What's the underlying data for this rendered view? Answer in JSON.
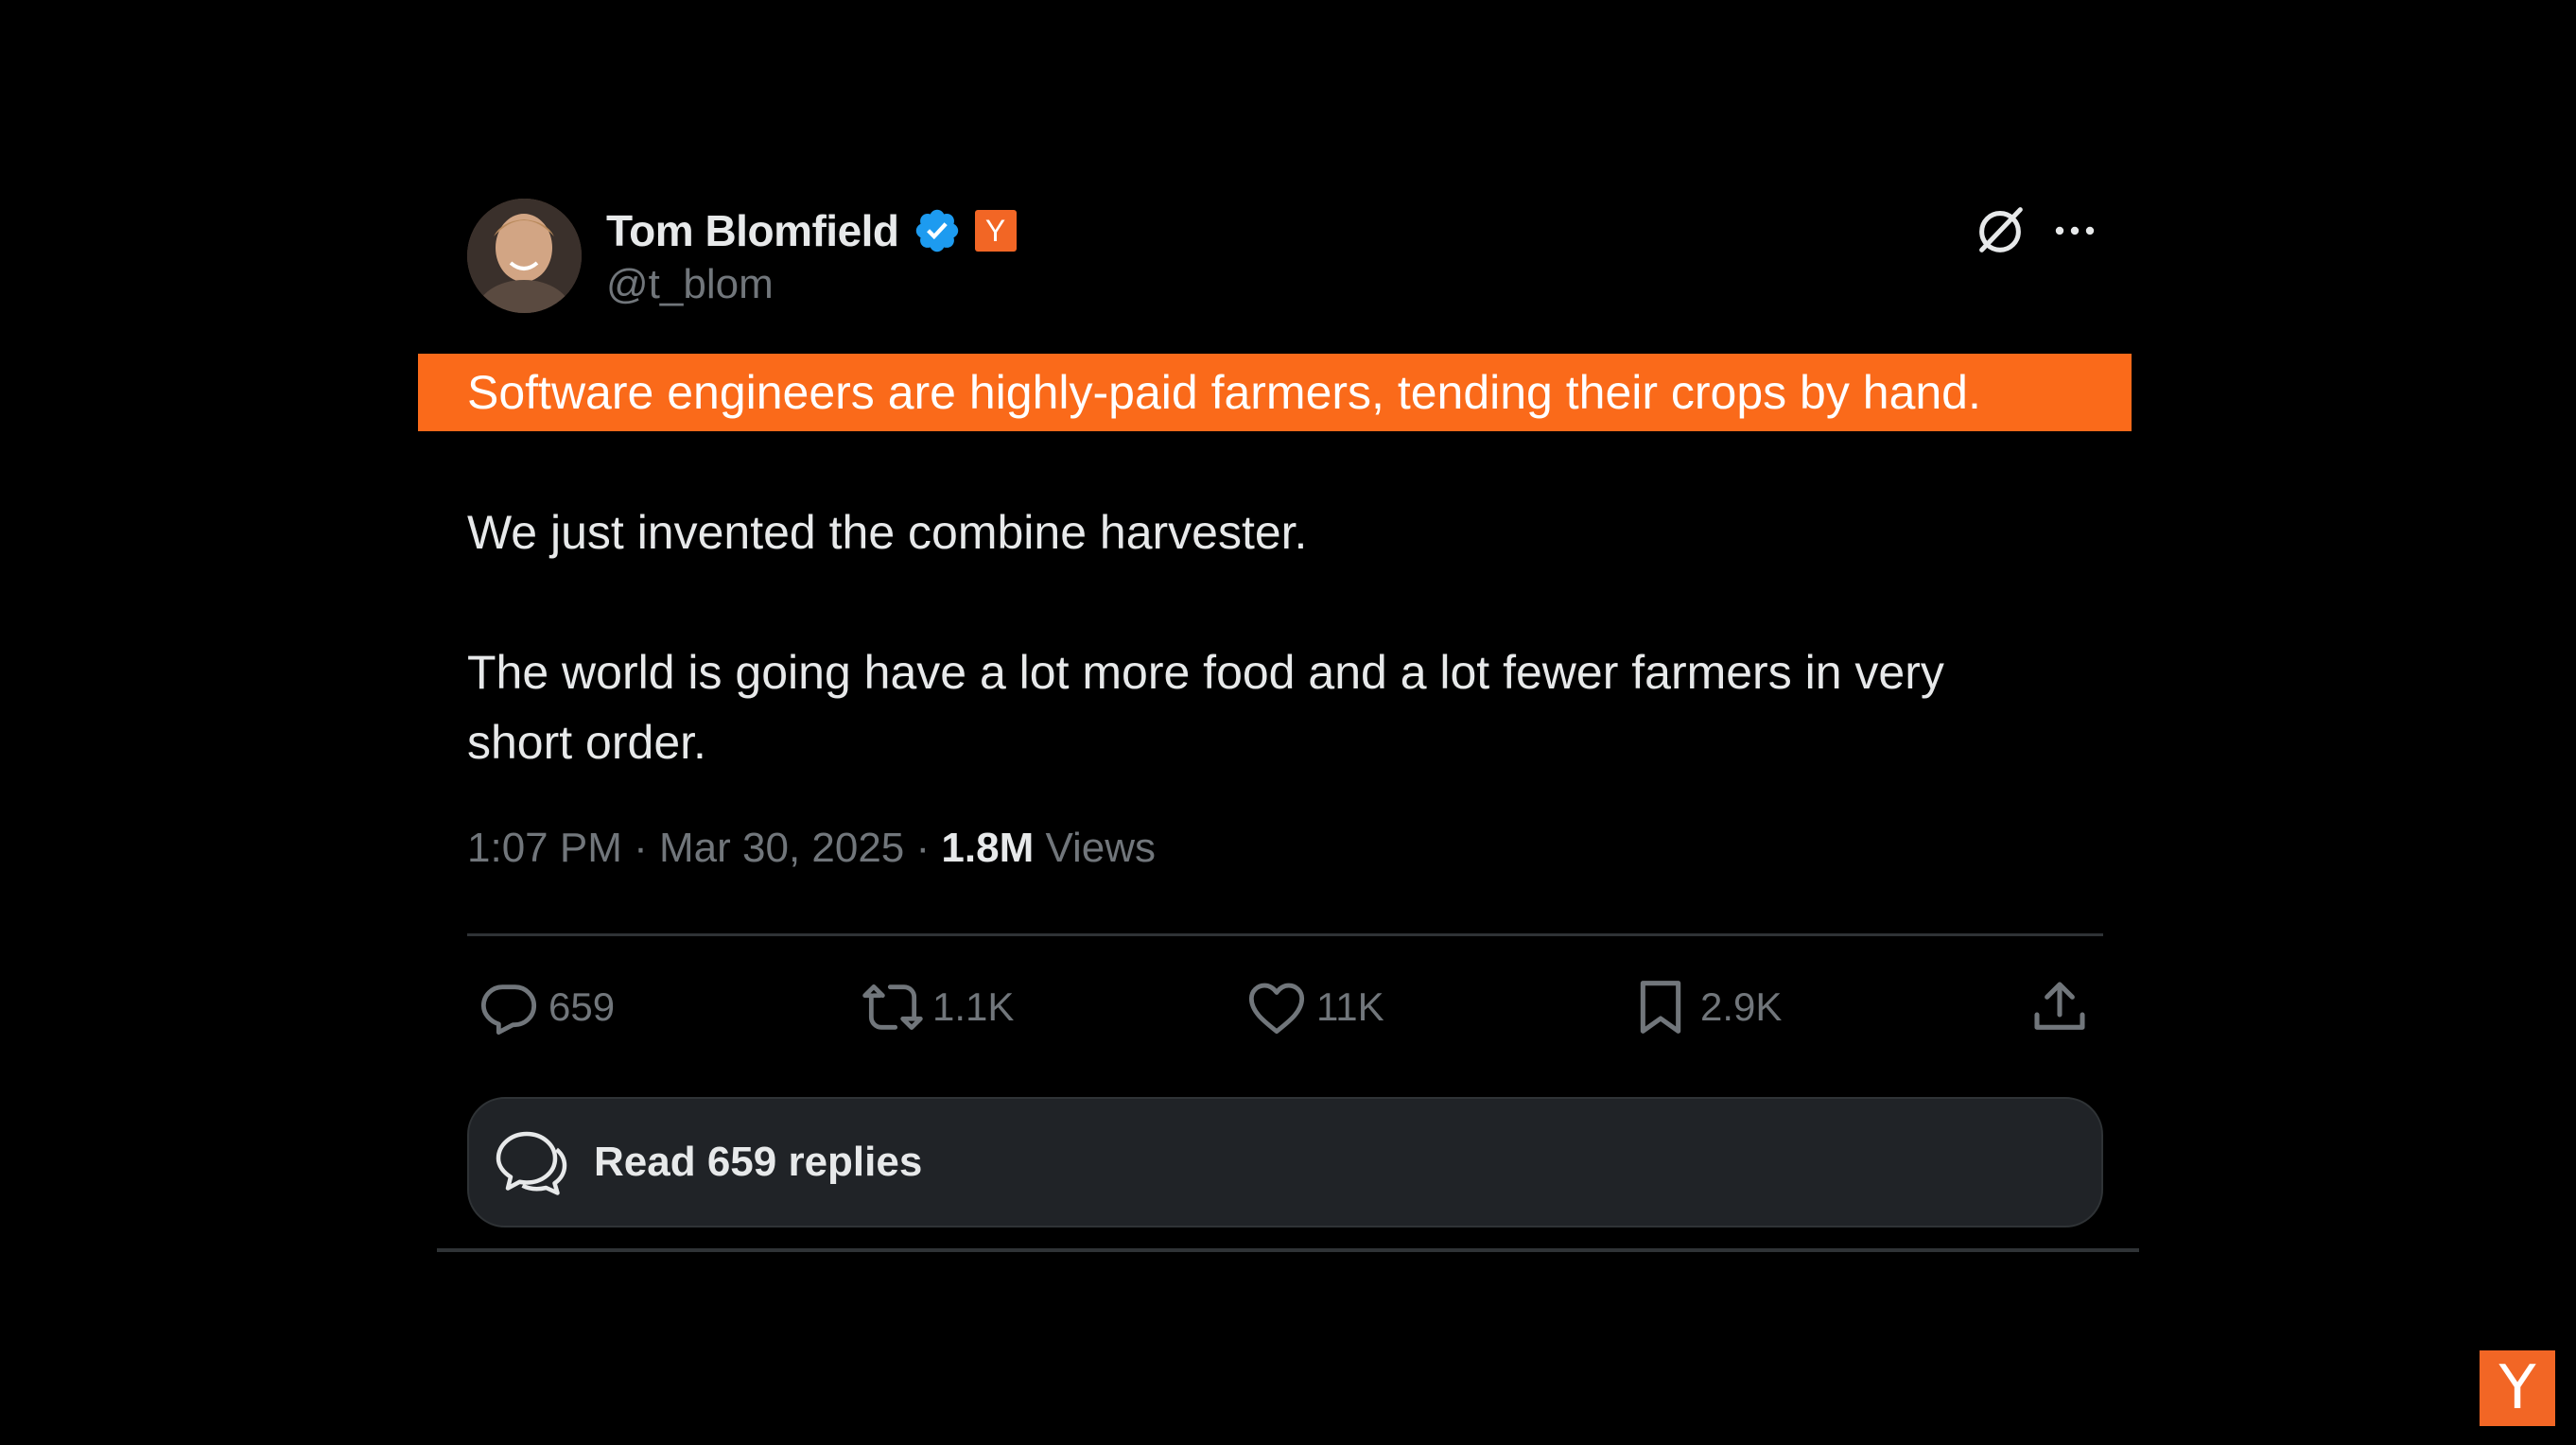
{
  "tweet": {
    "author_name": "Tom Blomfield",
    "handle": "@t_blom",
    "badge_text": "Y",
    "highlight_text": "Software engineers are highly-paid farmers, tending their crops by hand.",
    "line1": "We just invented the combine harvester.",
    "line2": "The world is going have a lot more food and a lot fewer farmers in very",
    "line3": "short order.",
    "time": "1:07 PM",
    "date": "Mar 30, 2025",
    "separator": "·",
    "views_count": "1.8M",
    "views_label": "Views"
  },
  "actions": {
    "replies": "659",
    "reposts": "1.1K",
    "likes": "11K",
    "bookmarks": "2.9K"
  },
  "read_replies_label": "Read 659 replies",
  "watermark_text": "Y",
  "colors": {
    "background": "#000000",
    "highlight": "#fa6a1a",
    "yc_orange": "#f26625",
    "verified_blue": "#1d9bf0",
    "muted_text": "#71767b",
    "primary_text": "#e7e9ea"
  },
  "icons": [
    "verified-icon",
    "grok-icon",
    "more-icon",
    "reply-icon",
    "repost-icon",
    "like-icon",
    "bookmark-icon",
    "share-icon",
    "replies-bubble-icon"
  ]
}
